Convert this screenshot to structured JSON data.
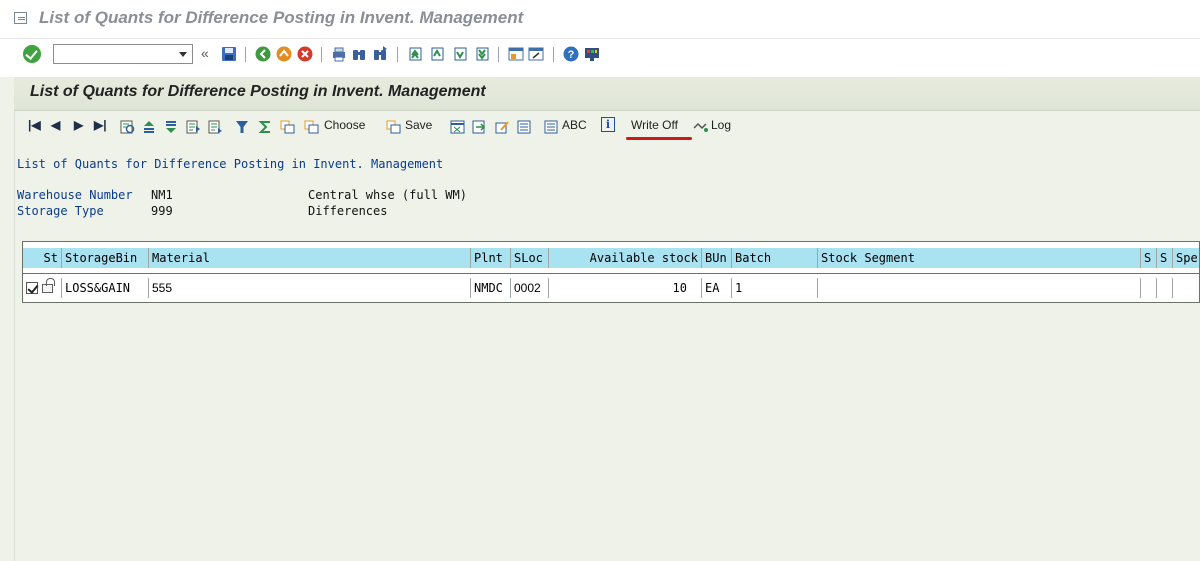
{
  "window": {
    "title": "List of Quants for Difference Posting in Invent. Management"
  },
  "system_toolbar": {
    "command_field_value": "",
    "icons": [
      "ok-icon",
      "save-icon",
      "back-icon",
      "exit-icon",
      "cancel-icon",
      "print-icon",
      "find-icon",
      "find-next-icon",
      "first-page-icon",
      "previous-page-icon",
      "next-page-icon",
      "last-page-icon",
      "create-session-icon",
      "shortcut-icon",
      "help-icon",
      "customize-layout-icon"
    ]
  },
  "app": {
    "title": "List of Quants for Difference Posting in Invent. Management",
    "toolbar": {
      "choose_label": "Choose",
      "save_label": "Save",
      "abc_label": "ABC",
      "info_label": "i",
      "write_off_label": "Write Off",
      "log_label": "Log"
    },
    "report_heading": "List of Quants for Difference Posting in Invent. Management",
    "header_fields": [
      {
        "label": "Warehouse Number",
        "value": "NM1",
        "description": "Central whse (full WM)"
      },
      {
        "label": "Storage Type",
        "value": "999",
        "description": "Differences"
      }
    ]
  },
  "grid": {
    "columns": [
      "St",
      "StorageBin",
      "Material",
      "Plnt",
      "SLoc",
      "Available stock",
      "BUn",
      "Batch",
      "Stock Segment",
      "S",
      "S",
      "Spe"
    ],
    "rows": [
      {
        "storage_bin": "LOSS&GAIN",
        "material": "555",
        "plant": "NMDC",
        "sloc": "0002",
        "available_stock": "10",
        "bun": "EA",
        "batch": "1",
        "stock_segment": "",
        "s1": "",
        "s2": "",
        "spe": ""
      }
    ]
  },
  "colors": {
    "header_cell": "#a9e2f0",
    "background": "#eef2e8",
    "annotation": "#cc1a1a"
  }
}
